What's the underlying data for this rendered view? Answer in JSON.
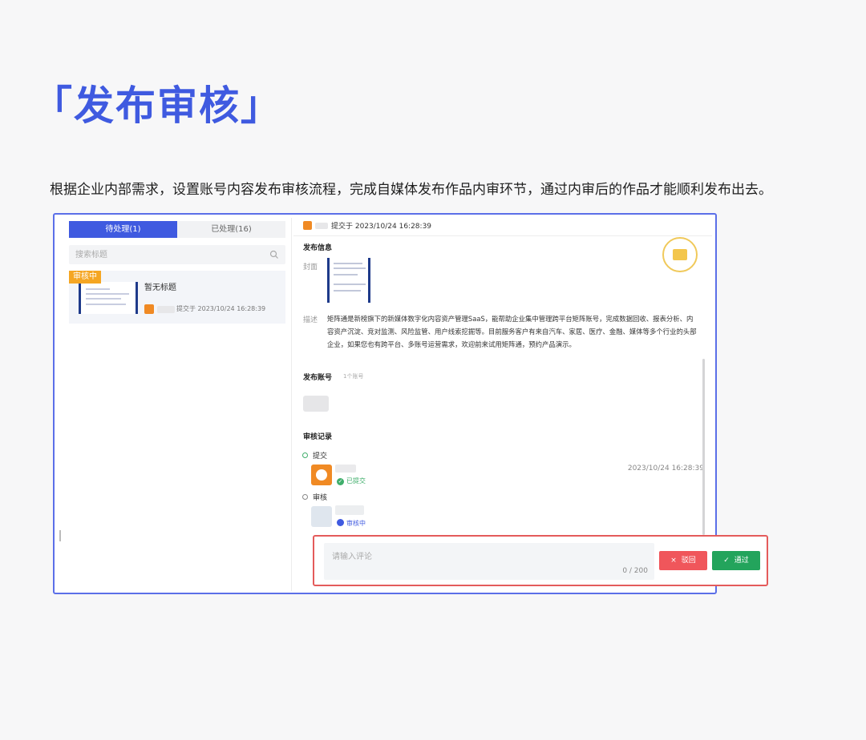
{
  "page": {
    "title": "「发布审核」",
    "description": "根据企业内部需求，设置账号内容发布审核流程，完成自媒体发布作品内审环节，通过内审后的作品才能顺利发布出去。"
  },
  "left_panel": {
    "tabs": [
      {
        "label": "待处理(1)",
        "active": true
      },
      {
        "label": "已处理(16)",
        "active": false
      }
    ],
    "search": {
      "placeholder": "搜索标题"
    },
    "items": [
      {
        "badge": "审核中",
        "title": "暂无标题",
        "submit_text": "提交于 2023/10/24 16:28:39"
      }
    ]
  },
  "detail": {
    "header_text": "提交于 2023/10/24 16:28:39",
    "publish_info_heading": "发布信息",
    "cover_label": "封面",
    "desc_label": "描述",
    "description": "矩阵通是新榜旗下的新媒体数字化内容资产管理SaaS，能帮助企业集中管理跨平台矩阵账号，完成数据回收、报表分析、内容资产沉淀、竞对监测、风险监管、用户线索挖掘等。目前服务客户有来自汽车、家居、医疗、金融、媒体等多个行业的头部企业，如果您也有跨平台、多账号运营需求，欢迎前来试用矩阵通，预约产品演示。",
    "account_heading": "发布账号",
    "account_count": "1个账号",
    "review_heading": "审核记录",
    "timeline": [
      {
        "label": "提交",
        "status": "已提交",
        "time": "2023/10/24 16:28:39"
      },
      {
        "label": "审核",
        "status": "审核中"
      }
    ]
  },
  "comment": {
    "placeholder": "请输入评论",
    "count": "0 / 200",
    "reject_label": "驳回",
    "approve_label": "通过"
  },
  "colors": {
    "brand": "#3f5ae0",
    "reject": "#f0565b",
    "approve": "#23a45c",
    "badge": "#f5a623",
    "highlight": "#e45b5b"
  }
}
